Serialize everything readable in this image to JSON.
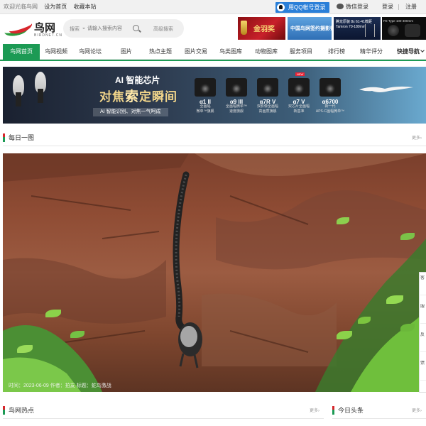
{
  "topbar": {
    "welcome": "欢迎光临鸟网",
    "set_home": "设为首页",
    "bookmark": "收藏本站",
    "qq_login": "用QQ帐号登录",
    "wechat_login": "微信登录",
    "login": "登录",
    "register": "注册"
  },
  "header": {
    "logo_name": "鸟网",
    "logo_domain": "BIRDNET.CN",
    "search_scope": "搜索",
    "search_placeholder": "请输入搜索内容",
    "advanced_search": "高级搜索"
  },
  "ads": {
    "ad1": "金羽奖",
    "ad2": "中国鸟网签约摄影师",
    "ad3_line1": "腾龙原装 8x 61-41微距",
    "ad3_line2": "Tamron 70-180mm",
    "ad4": "FE Type 100-400mm"
  },
  "nav": {
    "items": [
      {
        "label": "鸟网首页"
      },
      {
        "label": "鸟网视频"
      },
      {
        "label": "鸟网论坛"
      },
      {
        "label": "图片"
      },
      {
        "label": "热点主题"
      },
      {
        "label": "图片交易"
      },
      {
        "label": "鸟类图库"
      },
      {
        "label": "动物图库"
      },
      {
        "label": "服务项目"
      },
      {
        "label": "排行榜"
      },
      {
        "label": "精华评分"
      },
      {
        "label": "快捷导航"
      }
    ]
  },
  "banner": {
    "title1": "AI 智能芯片",
    "title2_a": "对焦",
    "title2_hi": "索",
    "title2_b": "定瞬间",
    "tagline": "AI 智能识别、对焦一气呵成",
    "new_tag": "NEW",
    "models": [
      {
        "name": "α1 II",
        "f1": "全画幅",
        "f2": "微单™旗舰"
      },
      {
        "name": "α9 III",
        "f1": "全画幅微单™",
        "f2": "速度旗舰"
      },
      {
        "name": "α7R V",
        "f1": "双影像全画幅",
        "f2": "高画质旗舰"
      },
      {
        "name": "α7 V",
        "f1": "双芯片全画幅",
        "f2": "新基准"
      },
      {
        "name": "α6700",
        "f1": "新一代",
        "f2": "APS-C画幅微单™"
      }
    ]
  },
  "daily": {
    "title": "每日一图",
    "more": "更多›",
    "caption": "时间：2023-06-09 作者：拍友 标题：蛇鸟激战"
  },
  "hot": {
    "title": "鸟网热点",
    "more": "更多›"
  },
  "headlines": {
    "title": "今日头条",
    "more": "更多›"
  },
  "sidetab": [
    "客",
    "服",
    "反",
    "馈"
  ]
}
